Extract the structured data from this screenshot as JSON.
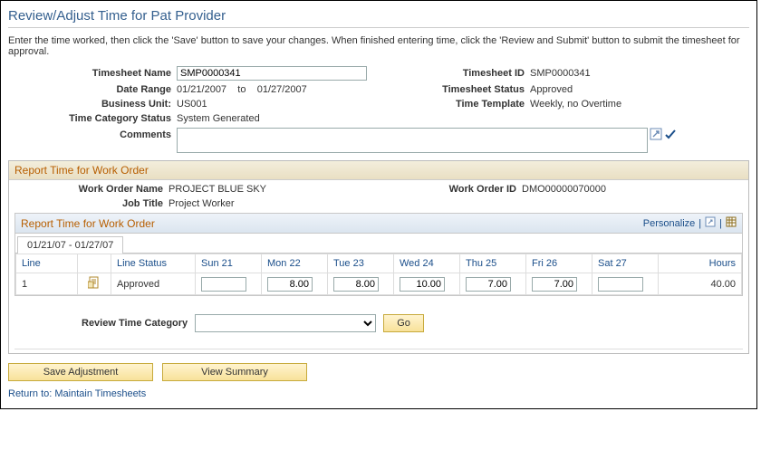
{
  "page": {
    "title": "Review/Adjust Time for Pat Provider",
    "instructions": "Enter the time worked, then click the 'Save' button to save your changes. When finished entering time, click the 'Review and Submit' button to submit the timesheet for approval."
  },
  "header": {
    "timesheet_name_label": "Timesheet Name",
    "timesheet_name_value": "SMP0000341",
    "timesheet_id_label": "Timesheet ID",
    "timesheet_id_value": "SMP0000341",
    "date_range_label": "Date Range",
    "date_from": "01/21/2007",
    "date_to_word": "to",
    "date_to": "01/27/2007",
    "timesheet_status_label": "Timesheet Status",
    "timesheet_status_value": "Approved",
    "business_unit_label": "Business Unit:",
    "business_unit_value": "US001",
    "time_template_label": "Time Template",
    "time_template_value": "Weekly, no Overtime",
    "time_cat_status_label": "Time Category Status",
    "time_cat_status_value": "System Generated",
    "comments_label": "Comments"
  },
  "work_order_section": {
    "title": "Report Time for Work Order",
    "wo_name_label": "Work Order Name",
    "wo_name_value": "PROJECT BLUE SKY",
    "wo_id_label": "Work Order ID",
    "wo_id_value": "DMO00000070000",
    "job_title_label": "Job Title",
    "job_title_value": "Project Worker"
  },
  "grid": {
    "title": "Report Time for Work Order",
    "personalize": "Personalize",
    "tab_label": "01/21/07 - 01/27/07",
    "columns": {
      "line": "Line",
      "icon": "",
      "status": "Line Status",
      "sun": "Sun 21",
      "mon": "Mon 22",
      "tue": "Tue 23",
      "wed": "Wed 24",
      "thu": "Thu 25",
      "fri": "Fri 26",
      "sat": "Sat 27",
      "hours": "Hours"
    },
    "rows": [
      {
        "line": "1",
        "status": "Approved",
        "sun": "",
        "mon": "8.00",
        "tue": "8.00",
        "wed": "10.00",
        "thu": "7.00",
        "fri": "7.00",
        "sat": "",
        "hours": "40.00"
      }
    ]
  },
  "review": {
    "label": "Review Time Category",
    "go": "Go"
  },
  "buttons": {
    "save": "Save Adjustment",
    "view_summary": "View Summary"
  },
  "footer": {
    "return_link": "Return to: Maintain Timesheets"
  }
}
